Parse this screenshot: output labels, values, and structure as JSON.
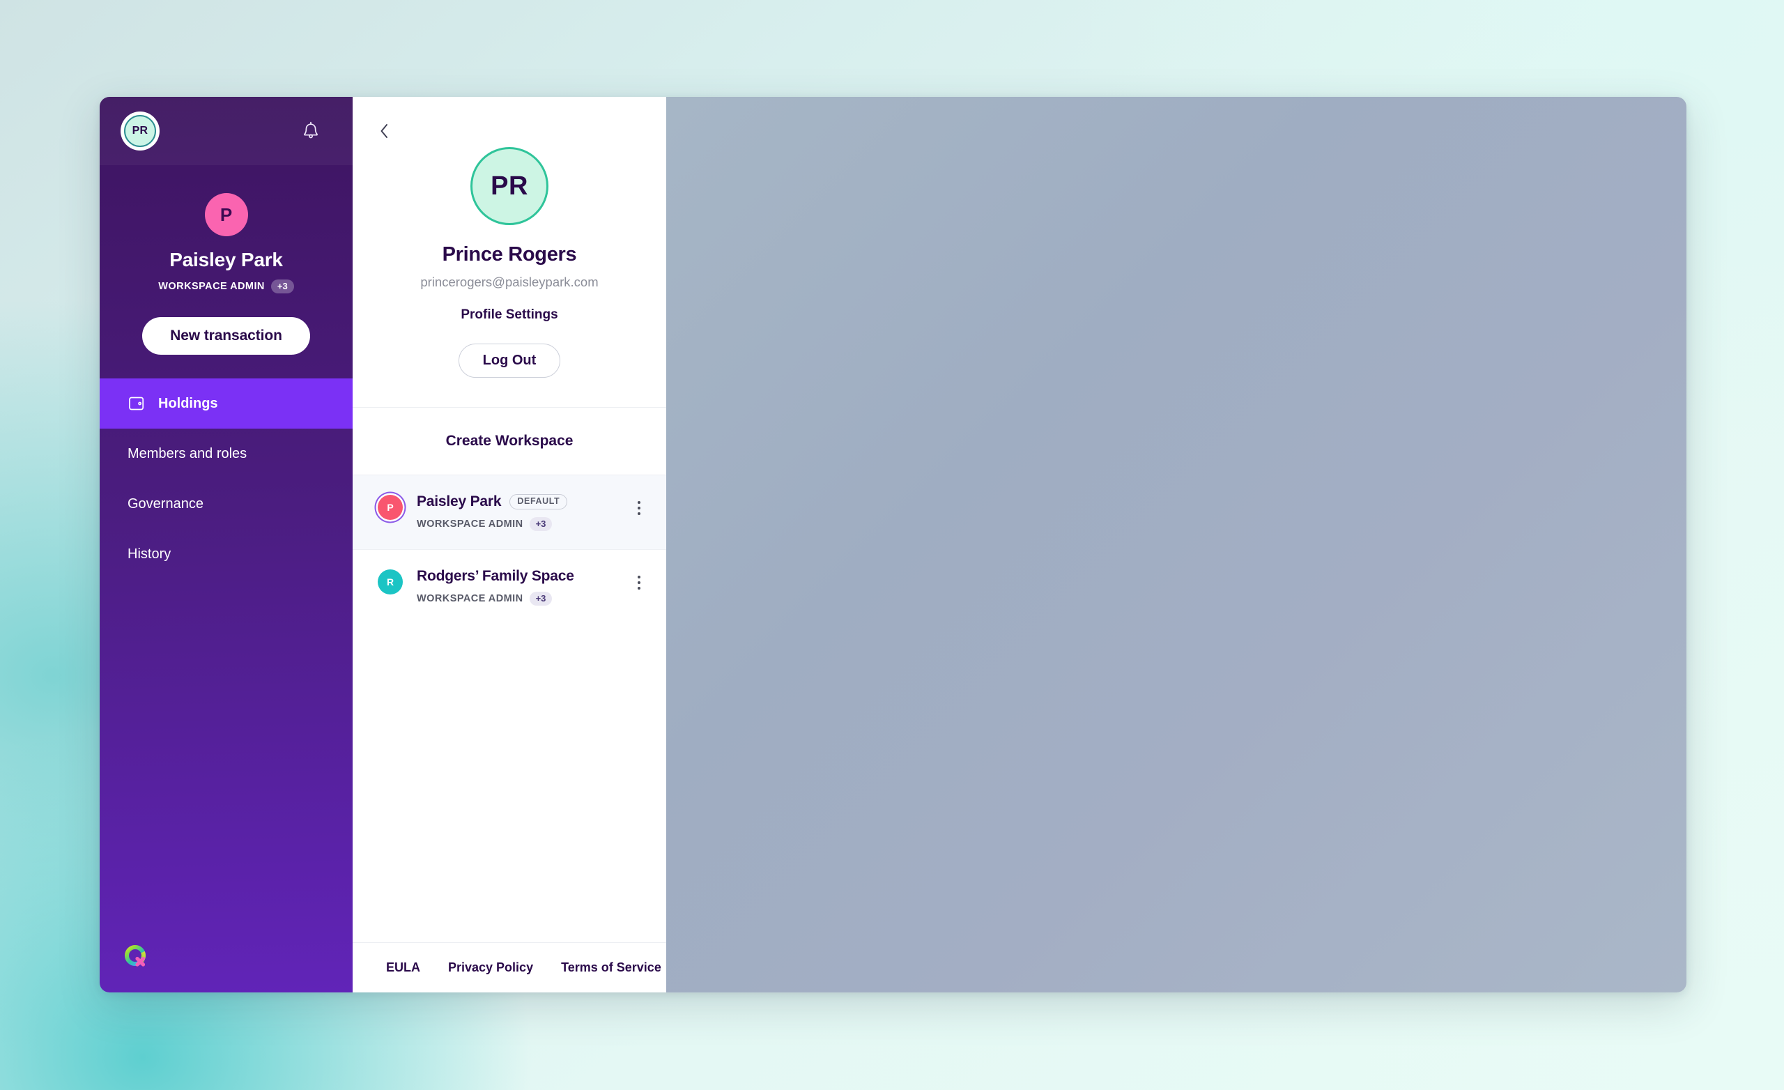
{
  "sidebar": {
    "header": {
      "avatar_initials": "PR",
      "avatar_icon": "user-avatar",
      "bell_icon": "bell-icon"
    },
    "workspace": {
      "avatar_initial": "P",
      "name": "Paisley Park",
      "role": "WORKSPACE ADMIN",
      "extra_roles": "+3"
    },
    "new_transaction_label": "New transaction",
    "nav_items": [
      {
        "label": "Holdings",
        "icon": "wallet-icon",
        "active": true
      },
      {
        "label": "Members and roles",
        "icon": "",
        "active": false
      },
      {
        "label": "Governance",
        "icon": "",
        "active": false
      },
      {
        "label": "History",
        "icon": "",
        "active": false
      }
    ],
    "logo_icon": "qredo-ring-logo"
  },
  "panel": {
    "back_icon": "chevron-left-icon",
    "profile": {
      "avatar_initials": "PR",
      "name": "Prince Rogers",
      "email": "princerogers@paisleypark.com",
      "settings_label": "Profile Settings",
      "logout_label": "Log Out"
    },
    "create_workspace_label": "Create Workspace",
    "workspaces": [
      {
        "avatar_initial": "P",
        "avatar_color": "#f9566f",
        "name": "Paisley Park",
        "badge": "DEFAULT",
        "role": "WORKSPACE ADMIN",
        "extra_roles": "+3",
        "selected": true,
        "menu_icon": "kebab-menu-icon"
      },
      {
        "avatar_initial": "R",
        "avatar_color": "#1bc4c4",
        "name": "Rodgers’ Family Space",
        "badge": "",
        "role": "WORKSPACE ADMIN",
        "extra_roles": "+3",
        "selected": false,
        "menu_icon": "kebab-menu-icon"
      }
    ],
    "footer_links": [
      {
        "label": "EULA"
      },
      {
        "label": "Privacy Policy"
      },
      {
        "label": "Terms of Service"
      }
    ]
  },
  "colors": {
    "sidebar_top": "#3d1560",
    "sidebar_bottom": "#6124b8",
    "nav_active": "#7b31f5",
    "accent_pink": "#fa64b0",
    "accent_mint": "#cdf5e4",
    "accent_teal": "#2fc49a",
    "text_dark": "#2a0a4a",
    "backdrop": "#a3aec4"
  }
}
